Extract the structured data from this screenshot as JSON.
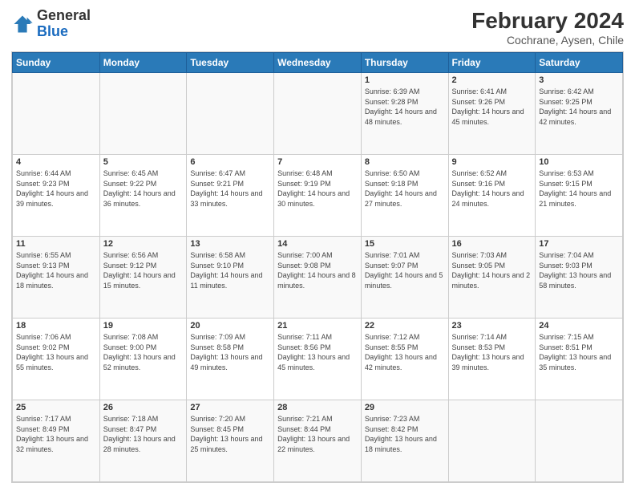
{
  "logo": {
    "text_general": "General",
    "text_blue": "Blue"
  },
  "header": {
    "title": "February 2024",
    "subtitle": "Cochrane, Aysen, Chile"
  },
  "days_of_week": [
    "Sunday",
    "Monday",
    "Tuesday",
    "Wednesday",
    "Thursday",
    "Friday",
    "Saturday"
  ],
  "weeks": [
    [
      {
        "day": "",
        "info": ""
      },
      {
        "day": "",
        "info": ""
      },
      {
        "day": "",
        "info": ""
      },
      {
        "day": "",
        "info": ""
      },
      {
        "day": "1",
        "info": "Sunrise: 6:39 AM\nSunset: 9:28 PM\nDaylight: 14 hours and 48 minutes."
      },
      {
        "day": "2",
        "info": "Sunrise: 6:41 AM\nSunset: 9:26 PM\nDaylight: 14 hours and 45 minutes."
      },
      {
        "day": "3",
        "info": "Sunrise: 6:42 AM\nSunset: 9:25 PM\nDaylight: 14 hours and 42 minutes."
      }
    ],
    [
      {
        "day": "4",
        "info": "Sunrise: 6:44 AM\nSunset: 9:23 PM\nDaylight: 14 hours and 39 minutes."
      },
      {
        "day": "5",
        "info": "Sunrise: 6:45 AM\nSunset: 9:22 PM\nDaylight: 14 hours and 36 minutes."
      },
      {
        "day": "6",
        "info": "Sunrise: 6:47 AM\nSunset: 9:21 PM\nDaylight: 14 hours and 33 minutes."
      },
      {
        "day": "7",
        "info": "Sunrise: 6:48 AM\nSunset: 9:19 PM\nDaylight: 14 hours and 30 minutes."
      },
      {
        "day": "8",
        "info": "Sunrise: 6:50 AM\nSunset: 9:18 PM\nDaylight: 14 hours and 27 minutes."
      },
      {
        "day": "9",
        "info": "Sunrise: 6:52 AM\nSunset: 9:16 PM\nDaylight: 14 hours and 24 minutes."
      },
      {
        "day": "10",
        "info": "Sunrise: 6:53 AM\nSunset: 9:15 PM\nDaylight: 14 hours and 21 minutes."
      }
    ],
    [
      {
        "day": "11",
        "info": "Sunrise: 6:55 AM\nSunset: 9:13 PM\nDaylight: 14 hours and 18 minutes."
      },
      {
        "day": "12",
        "info": "Sunrise: 6:56 AM\nSunset: 9:12 PM\nDaylight: 14 hours and 15 minutes."
      },
      {
        "day": "13",
        "info": "Sunrise: 6:58 AM\nSunset: 9:10 PM\nDaylight: 14 hours and 11 minutes."
      },
      {
        "day": "14",
        "info": "Sunrise: 7:00 AM\nSunset: 9:08 PM\nDaylight: 14 hours and 8 minutes."
      },
      {
        "day": "15",
        "info": "Sunrise: 7:01 AM\nSunset: 9:07 PM\nDaylight: 14 hours and 5 minutes."
      },
      {
        "day": "16",
        "info": "Sunrise: 7:03 AM\nSunset: 9:05 PM\nDaylight: 14 hours and 2 minutes."
      },
      {
        "day": "17",
        "info": "Sunrise: 7:04 AM\nSunset: 9:03 PM\nDaylight: 13 hours and 58 minutes."
      }
    ],
    [
      {
        "day": "18",
        "info": "Sunrise: 7:06 AM\nSunset: 9:02 PM\nDaylight: 13 hours and 55 minutes."
      },
      {
        "day": "19",
        "info": "Sunrise: 7:08 AM\nSunset: 9:00 PM\nDaylight: 13 hours and 52 minutes."
      },
      {
        "day": "20",
        "info": "Sunrise: 7:09 AM\nSunset: 8:58 PM\nDaylight: 13 hours and 49 minutes."
      },
      {
        "day": "21",
        "info": "Sunrise: 7:11 AM\nSunset: 8:56 PM\nDaylight: 13 hours and 45 minutes."
      },
      {
        "day": "22",
        "info": "Sunrise: 7:12 AM\nSunset: 8:55 PM\nDaylight: 13 hours and 42 minutes."
      },
      {
        "day": "23",
        "info": "Sunrise: 7:14 AM\nSunset: 8:53 PM\nDaylight: 13 hours and 39 minutes."
      },
      {
        "day": "24",
        "info": "Sunrise: 7:15 AM\nSunset: 8:51 PM\nDaylight: 13 hours and 35 minutes."
      }
    ],
    [
      {
        "day": "25",
        "info": "Sunrise: 7:17 AM\nSunset: 8:49 PM\nDaylight: 13 hours and 32 minutes."
      },
      {
        "day": "26",
        "info": "Sunrise: 7:18 AM\nSunset: 8:47 PM\nDaylight: 13 hours and 28 minutes."
      },
      {
        "day": "27",
        "info": "Sunrise: 7:20 AM\nSunset: 8:45 PM\nDaylight: 13 hours and 25 minutes."
      },
      {
        "day": "28",
        "info": "Sunrise: 7:21 AM\nSunset: 8:44 PM\nDaylight: 13 hours and 22 minutes."
      },
      {
        "day": "29",
        "info": "Sunrise: 7:23 AM\nSunset: 8:42 PM\nDaylight: 13 hours and 18 minutes."
      },
      {
        "day": "",
        "info": ""
      },
      {
        "day": "",
        "info": ""
      }
    ]
  ]
}
